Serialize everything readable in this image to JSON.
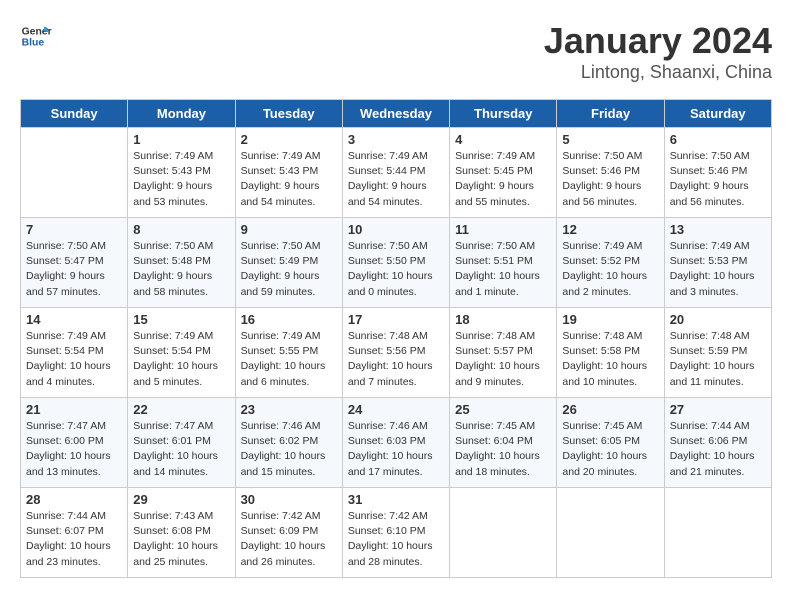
{
  "header": {
    "logo_line1": "General",
    "logo_line2": "Blue",
    "title": "January 2024",
    "subtitle": "Lintong, Shaanxi, China"
  },
  "columns": [
    "Sunday",
    "Monday",
    "Tuesday",
    "Wednesday",
    "Thursday",
    "Friday",
    "Saturday"
  ],
  "weeks": [
    [
      {
        "day": "",
        "info": ""
      },
      {
        "day": "1",
        "info": "Sunrise: 7:49 AM\nSunset: 5:43 PM\nDaylight: 9 hours\nand 53 minutes."
      },
      {
        "day": "2",
        "info": "Sunrise: 7:49 AM\nSunset: 5:43 PM\nDaylight: 9 hours\nand 54 minutes."
      },
      {
        "day": "3",
        "info": "Sunrise: 7:49 AM\nSunset: 5:44 PM\nDaylight: 9 hours\nand 54 minutes."
      },
      {
        "day": "4",
        "info": "Sunrise: 7:49 AM\nSunset: 5:45 PM\nDaylight: 9 hours\nand 55 minutes."
      },
      {
        "day": "5",
        "info": "Sunrise: 7:50 AM\nSunset: 5:46 PM\nDaylight: 9 hours\nand 56 minutes."
      },
      {
        "day": "6",
        "info": "Sunrise: 7:50 AM\nSunset: 5:46 PM\nDaylight: 9 hours\nand 56 minutes."
      }
    ],
    [
      {
        "day": "7",
        "info": "Sunrise: 7:50 AM\nSunset: 5:47 PM\nDaylight: 9 hours\nand 57 minutes."
      },
      {
        "day": "8",
        "info": "Sunrise: 7:50 AM\nSunset: 5:48 PM\nDaylight: 9 hours\nand 58 minutes."
      },
      {
        "day": "9",
        "info": "Sunrise: 7:50 AM\nSunset: 5:49 PM\nDaylight: 9 hours\nand 59 minutes."
      },
      {
        "day": "10",
        "info": "Sunrise: 7:50 AM\nSunset: 5:50 PM\nDaylight: 10 hours\nand 0 minutes."
      },
      {
        "day": "11",
        "info": "Sunrise: 7:50 AM\nSunset: 5:51 PM\nDaylight: 10 hours\nand 1 minute."
      },
      {
        "day": "12",
        "info": "Sunrise: 7:49 AM\nSunset: 5:52 PM\nDaylight: 10 hours\nand 2 minutes."
      },
      {
        "day": "13",
        "info": "Sunrise: 7:49 AM\nSunset: 5:53 PM\nDaylight: 10 hours\nand 3 minutes."
      }
    ],
    [
      {
        "day": "14",
        "info": "Sunrise: 7:49 AM\nSunset: 5:54 PM\nDaylight: 10 hours\nand 4 minutes."
      },
      {
        "day": "15",
        "info": "Sunrise: 7:49 AM\nSunset: 5:54 PM\nDaylight: 10 hours\nand 5 minutes."
      },
      {
        "day": "16",
        "info": "Sunrise: 7:49 AM\nSunset: 5:55 PM\nDaylight: 10 hours\nand 6 minutes."
      },
      {
        "day": "17",
        "info": "Sunrise: 7:48 AM\nSunset: 5:56 PM\nDaylight: 10 hours\nand 7 minutes."
      },
      {
        "day": "18",
        "info": "Sunrise: 7:48 AM\nSunset: 5:57 PM\nDaylight: 10 hours\nand 9 minutes."
      },
      {
        "day": "19",
        "info": "Sunrise: 7:48 AM\nSunset: 5:58 PM\nDaylight: 10 hours\nand 10 minutes."
      },
      {
        "day": "20",
        "info": "Sunrise: 7:48 AM\nSunset: 5:59 PM\nDaylight: 10 hours\nand 11 minutes."
      }
    ],
    [
      {
        "day": "21",
        "info": "Sunrise: 7:47 AM\nSunset: 6:00 PM\nDaylight: 10 hours\nand 13 minutes."
      },
      {
        "day": "22",
        "info": "Sunrise: 7:47 AM\nSunset: 6:01 PM\nDaylight: 10 hours\nand 14 minutes."
      },
      {
        "day": "23",
        "info": "Sunrise: 7:46 AM\nSunset: 6:02 PM\nDaylight: 10 hours\nand 15 minutes."
      },
      {
        "day": "24",
        "info": "Sunrise: 7:46 AM\nSunset: 6:03 PM\nDaylight: 10 hours\nand 17 minutes."
      },
      {
        "day": "25",
        "info": "Sunrise: 7:45 AM\nSunset: 6:04 PM\nDaylight: 10 hours\nand 18 minutes."
      },
      {
        "day": "26",
        "info": "Sunrise: 7:45 AM\nSunset: 6:05 PM\nDaylight: 10 hours\nand 20 minutes."
      },
      {
        "day": "27",
        "info": "Sunrise: 7:44 AM\nSunset: 6:06 PM\nDaylight: 10 hours\nand 21 minutes."
      }
    ],
    [
      {
        "day": "28",
        "info": "Sunrise: 7:44 AM\nSunset: 6:07 PM\nDaylight: 10 hours\nand 23 minutes."
      },
      {
        "day": "29",
        "info": "Sunrise: 7:43 AM\nSunset: 6:08 PM\nDaylight: 10 hours\nand 25 minutes."
      },
      {
        "day": "30",
        "info": "Sunrise: 7:42 AM\nSunset: 6:09 PM\nDaylight: 10 hours\nand 26 minutes."
      },
      {
        "day": "31",
        "info": "Sunrise: 7:42 AM\nSunset: 6:10 PM\nDaylight: 10 hours\nand 28 minutes."
      },
      {
        "day": "",
        "info": ""
      },
      {
        "day": "",
        "info": ""
      },
      {
        "day": "",
        "info": ""
      }
    ]
  ]
}
